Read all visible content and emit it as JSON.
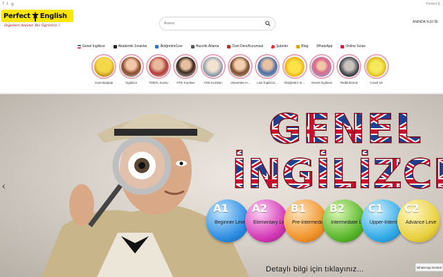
{
  "topbar": {
    "social_icons": [
      "facebook-icon",
      "twitter-icon",
      "instagram-icon"
    ],
    "right_text": "Perfect E"
  },
  "logo": {
    "brand_left": "Perfect",
    "brand_right": "English",
    "tagline": "Diğerleri Anlatır, Biz Öğretiriz !"
  },
  "search": {
    "placeholder": "Arama",
    "icon": "search-icon"
  },
  "promo": {
    "text": "ANINDA %10 İN"
  },
  "menu": {
    "items": [
      {
        "label": "Genel İngilizce",
        "icon": "uk-flag-icon"
      },
      {
        "label": "Akademik Sınavlar",
        "icon": "graduation-cap-icon"
      },
      {
        "label": "İlköğretim/Lise",
        "icon": "book-icon"
      },
      {
        "label": "Hazırlık Atlama",
        "icon": "plane-icon"
      },
      {
        "label": "Özel Ders/Kurumsal",
        "icon": "briefcase-icon"
      },
      {
        "label": "Şubeler",
        "icon": "pin-icon"
      },
      {
        "label": "Blog",
        "icon": "pencil-icon"
      },
      {
        "label": "WhatsApp",
        "icon": ""
      },
      {
        "label": "Online Sınav",
        "icon": "clipboard-icon"
      }
    ]
  },
  "stories": [
    {
      "label": "Kurs Başladı"
    },
    {
      "label": "İngilizce"
    },
    {
      "label": "TOEFL Kursu"
    },
    {
      "label": "PTE Kursları"
    },
    {
      "label": "YDS Kursları"
    },
    {
      "label": "Üniversite H..."
    },
    {
      "label": "Lise İngilizce..."
    },
    {
      "label": "İlköğretim İn..."
    },
    {
      "label": "Genel İngilizce"
    },
    {
      "label": "Tedbirlerimiz"
    },
    {
      "label": "Covid-19"
    }
  ],
  "hero": {
    "headline_line1": "GENEL",
    "headline_line2": "İNGİLİZCE",
    "cta": "Detaylı bilgi için tıklayınız...",
    "whatsapp_tab": "WhatsApp Destek",
    "levels": [
      {
        "code": "A1",
        "name": "Beginner Level",
        "color": "#2a8be0"
      },
      {
        "code": "A2",
        "name": "Elementary Level",
        "color": "#d236b4"
      },
      {
        "code": "B1",
        "name": "Pre-Intermediate Level",
        "color": "#f0932a"
      },
      {
        "code": "B2",
        "name": "Intermediate Level",
        "color": "#59b52a"
      },
      {
        "code": "C1",
        "name": "Upper-Intermediate Level",
        "color": "#2ea9e6"
      },
      {
        "code": "C2",
        "name": "Advance Level",
        "color": "#e8cf3c"
      }
    ]
  },
  "colors": {
    "logo_yellow": "#ffe600",
    "headline_red": "#c8102e",
    "headline_blue": "#1f3f8f",
    "story_ring": "#e4a6b8"
  }
}
